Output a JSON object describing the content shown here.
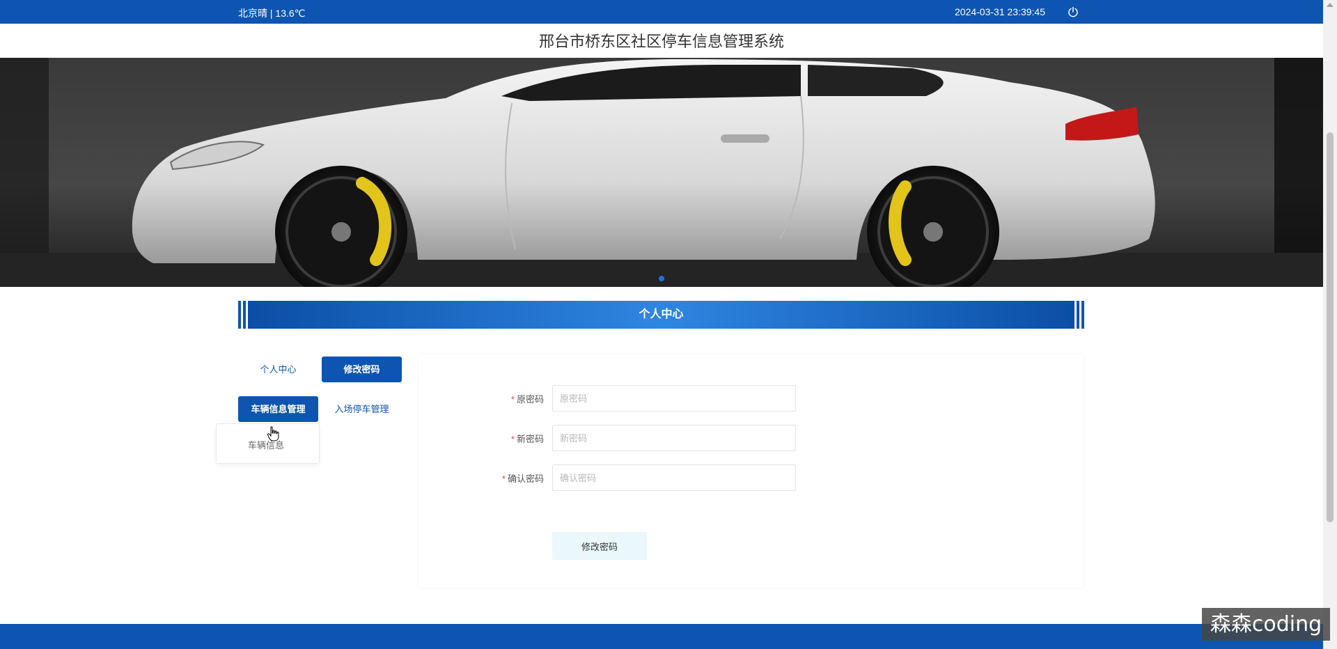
{
  "topbar": {
    "weather": "北京晴 | 13.6℃",
    "datetime": "2024-03-31   23:39:45",
    "power_icon": "power-icon"
  },
  "site_title": "邢台市桥东区社区停车信息管理系统",
  "banner": {
    "image": "white-sports-car"
  },
  "section_title": "个人中心",
  "menu": {
    "personal_center": "个人中心",
    "change_password": "修改密码",
    "vehicle_info_mgmt": "车辆信息管理",
    "entry_parking_mgmt": "入场停车管理",
    "dropdown_vehicle_info": "车辆信息"
  },
  "form": {
    "old_password": {
      "label": "原密码",
      "placeholder": "原密码",
      "value": ""
    },
    "new_password": {
      "label": "新密码",
      "placeholder": "新密码",
      "value": ""
    },
    "confirm_password": {
      "label": "确认密码",
      "placeholder": "确认密码",
      "value": ""
    },
    "required_mark": "*",
    "submit_label": "修改密码"
  },
  "watermark": "森森coding",
  "colors": {
    "primary": "#0d55b0",
    "required": "#e54545",
    "submit_bg": "#eaf7fb"
  }
}
